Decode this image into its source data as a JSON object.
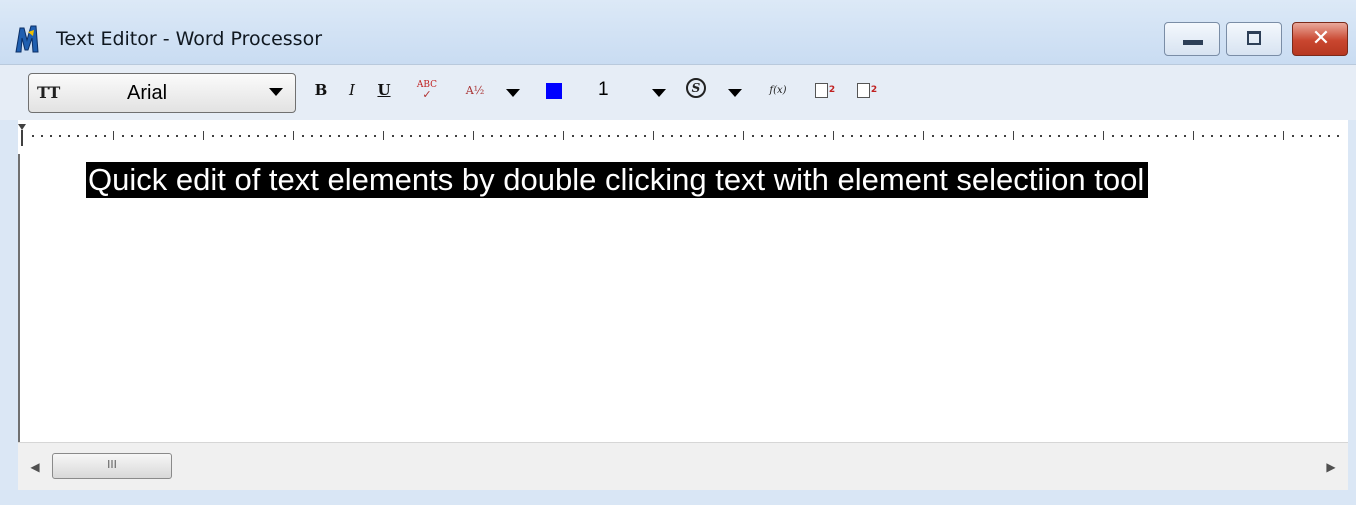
{
  "window": {
    "title": "Text Editor - Word Processor",
    "close_glyph": "✕"
  },
  "toolbar": {
    "font_icon": "TT",
    "font_name": "Arial",
    "bold_label": "B",
    "italic_label": "I",
    "underline_label": "U",
    "spellcheck_label": "ABC",
    "fraction_label": "A½",
    "color_value": "#0000ff",
    "size_value": "1",
    "underline_style_label": "S",
    "function_label": "f(x)",
    "superscript_label": "2",
    "subscript_label": "2"
  },
  "editor": {
    "selected_text": "Quick edit of text elements by double clicking text with element selectiion tool"
  },
  "scrollbar": {
    "thumb_grip": "III"
  },
  "icons": {
    "app": "microstation-app-icon",
    "minimize": "minimize-icon",
    "maximize": "maximize-icon",
    "close": "close-icon"
  }
}
